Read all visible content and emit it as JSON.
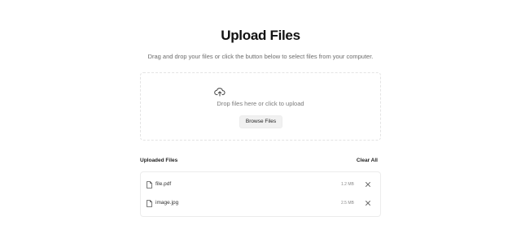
{
  "header": {
    "title": "Upload Files",
    "subtitle": "Drag and drop your files or click the button below to select files from your computer."
  },
  "dropzone": {
    "icon": "cloud-upload-icon",
    "text": "Drop files here or click to upload",
    "button_label": "Browse Files"
  },
  "uploaded": {
    "label": "Uploaded Files",
    "clear_all_label": "Clear All",
    "files": [
      {
        "name": "file.pdf",
        "size": "1.2 MB",
        "icon": "file-icon",
        "remove_icon": "close-icon"
      },
      {
        "name": "image.jpg",
        "size": "2.5 MB",
        "icon": "file-icon",
        "remove_icon": "close-icon"
      }
    ]
  }
}
